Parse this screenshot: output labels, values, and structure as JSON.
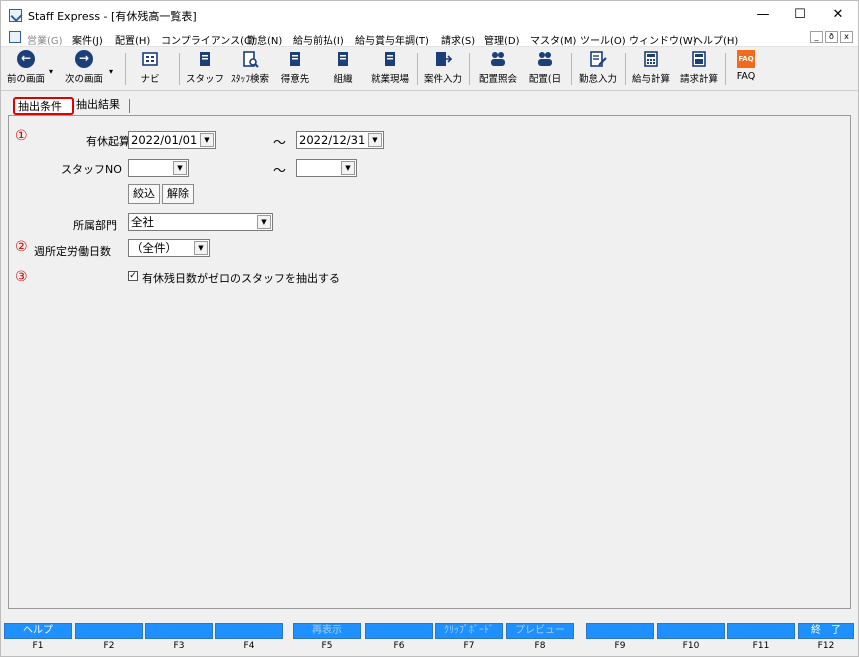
{
  "window": {
    "title": "Staff Express - [有休残高一覧表]",
    "min_glyph": "—",
    "max_glyph": "☐",
    "close_glyph": "✕"
  },
  "menu": {
    "items": [
      {
        "label": "営業(G)",
        "dim": true
      },
      {
        "label": "案件(J)"
      },
      {
        "label": "配置(H)"
      },
      {
        "label": "コンプライアンス(C)"
      },
      {
        "label": "勤怠(N)"
      },
      {
        "label": "給与前払(I)"
      },
      {
        "label": "給与賞与年調(T)"
      },
      {
        "label": "請求(S)"
      },
      {
        "label": "管理(D)"
      },
      {
        "label": "マスタ(M)"
      },
      {
        "label": "ツール(O)"
      },
      {
        "label": "ウィンドウ(W)"
      },
      {
        "label": "ヘルプ(H)"
      }
    ],
    "mdi": [
      "_",
      "ð",
      "x"
    ]
  },
  "toolbar": {
    "prev": "前の画面",
    "next": "次の画面",
    "navi": "ナビ",
    "staff": "スタッフ",
    "staff_search": "ｽﾀｯﾌ検索",
    "customer": "得意先",
    "org": "組織",
    "site": "就業現場",
    "case_input": "案件入力",
    "assign_ref": "配置照会",
    "assign_day": "配置(日",
    "attendance": "勤怠入力",
    "payroll": "給与計算",
    "billing": "請求計算",
    "faq": "FAQ",
    "faq_icon_text": "FAQ",
    "dd": "▾"
  },
  "tabs": {
    "active": "抽出条件",
    "other": "抽出結果"
  },
  "form": {
    "marker1": "①",
    "marker2": "②",
    "marker3": "③",
    "date_label": "有休起算日",
    "date_from": "2022/01/01",
    "date_to": "2022/12/31",
    "tilde": "～",
    "staff_label": "スタッフNO",
    "staff_from": "",
    "staff_to": "",
    "narrow_btn": "絞込",
    "clear_btn": "解除",
    "dept_label": "所属部門",
    "dept_value": "全社",
    "week_label": "週所定労働日数",
    "week_value": "（全件）",
    "check_label": "有休残日数がゼロのスタッフを抽出する",
    "check_mark": "✓",
    "arrow": "▼"
  },
  "fkeys": [
    {
      "label": "ヘルプ",
      "key": "F1"
    },
    {
      "label": "",
      "key": "F2"
    },
    {
      "label": "",
      "key": "F3"
    },
    {
      "label": "",
      "key": "F4"
    },
    {
      "label": "再表示",
      "key": "F5",
      "dim": true
    },
    {
      "label": "",
      "key": "F6"
    },
    {
      "label": "ｸﾘｯﾌﾟﾎﾞｰﾄﾞ",
      "key": "F7",
      "dim": true
    },
    {
      "label": "プレビュー",
      "key": "F8",
      "dim": true
    },
    {
      "label": "",
      "key": "F9"
    },
    {
      "label": "",
      "key": "F10"
    },
    {
      "label": "",
      "key": "F11"
    },
    {
      "label": "終　了",
      "key": "F12"
    }
  ]
}
